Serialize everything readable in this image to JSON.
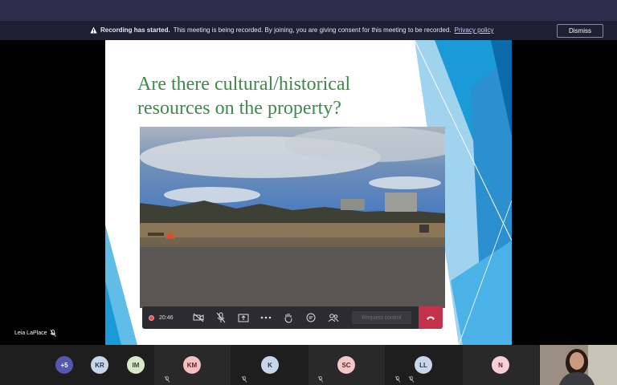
{
  "banner": {
    "bold": "Recording has started.",
    "message": "This meeting is being recorded. By joining, you are giving consent for this meeting to be recorded.",
    "link": "Privacy policy",
    "dismiss": "Dismiss"
  },
  "slide": {
    "title": "Are there cultural/historical resources on the property?"
  },
  "toolbar": {
    "timer": "20:46",
    "request_control": "Request control"
  },
  "presenter": {
    "name": "Leia LaPlace"
  },
  "participants": {
    "overflow": "+5",
    "items": [
      {
        "initials": "KR",
        "color": "#c8d6ec"
      },
      {
        "initials": "IM",
        "color": "#d8e8c8"
      },
      {
        "initials": "KM",
        "color": "#f2c0c0"
      },
      {
        "initials": "K",
        "color": "#c8d6ec"
      },
      {
        "initials": "SC",
        "color": "#f2c8c8"
      },
      {
        "initials": "LL",
        "color": "#c8d6ec"
      },
      {
        "initials": "N",
        "color": "#f8d0d8"
      }
    ]
  },
  "colors": {
    "accent_purple": "#5558af",
    "hangup_red": "#c4314b",
    "slide_title_green": "#3b8a45"
  }
}
